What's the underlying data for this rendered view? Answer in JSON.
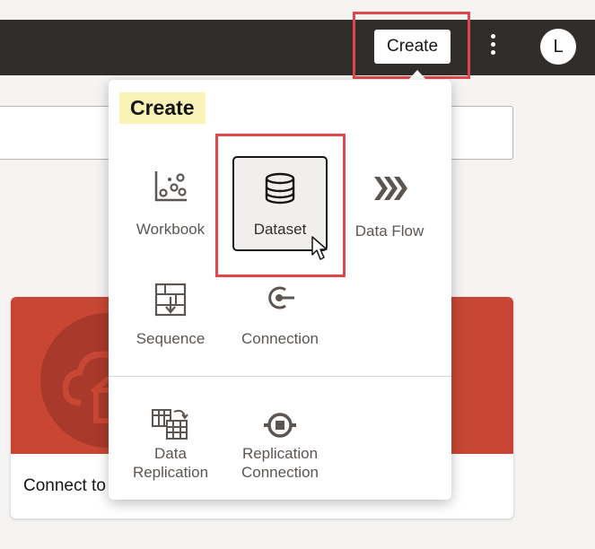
{
  "header": {
    "create_label": "Create",
    "more_icon": "kebab-icon",
    "avatar_letter": "L"
  },
  "card": {
    "text": "Connect to"
  },
  "create_menu": {
    "title": "Create",
    "items": [
      {
        "label": "Workbook",
        "icon": "workbook-icon"
      },
      {
        "label": "Dataset",
        "icon": "database-icon"
      },
      {
        "label": "Data Flow",
        "icon": "data-flow-icon"
      },
      {
        "label": "Sequence",
        "icon": "sequence-icon"
      },
      {
        "label": "Connection",
        "icon": "connection-icon"
      }
    ],
    "replication_items": [
      {
        "label_line1": "Data",
        "label_line2": "Replication",
        "icon": "data-replication-icon"
      },
      {
        "label_line1": "Replication",
        "label_line2": "Connection",
        "icon": "replication-connection-icon"
      }
    ]
  },
  "colors": {
    "topbar": "#312d2a",
    "highlight": "#e0474c",
    "card_accent": "#c74634",
    "title_bg": "#faf3b8"
  }
}
